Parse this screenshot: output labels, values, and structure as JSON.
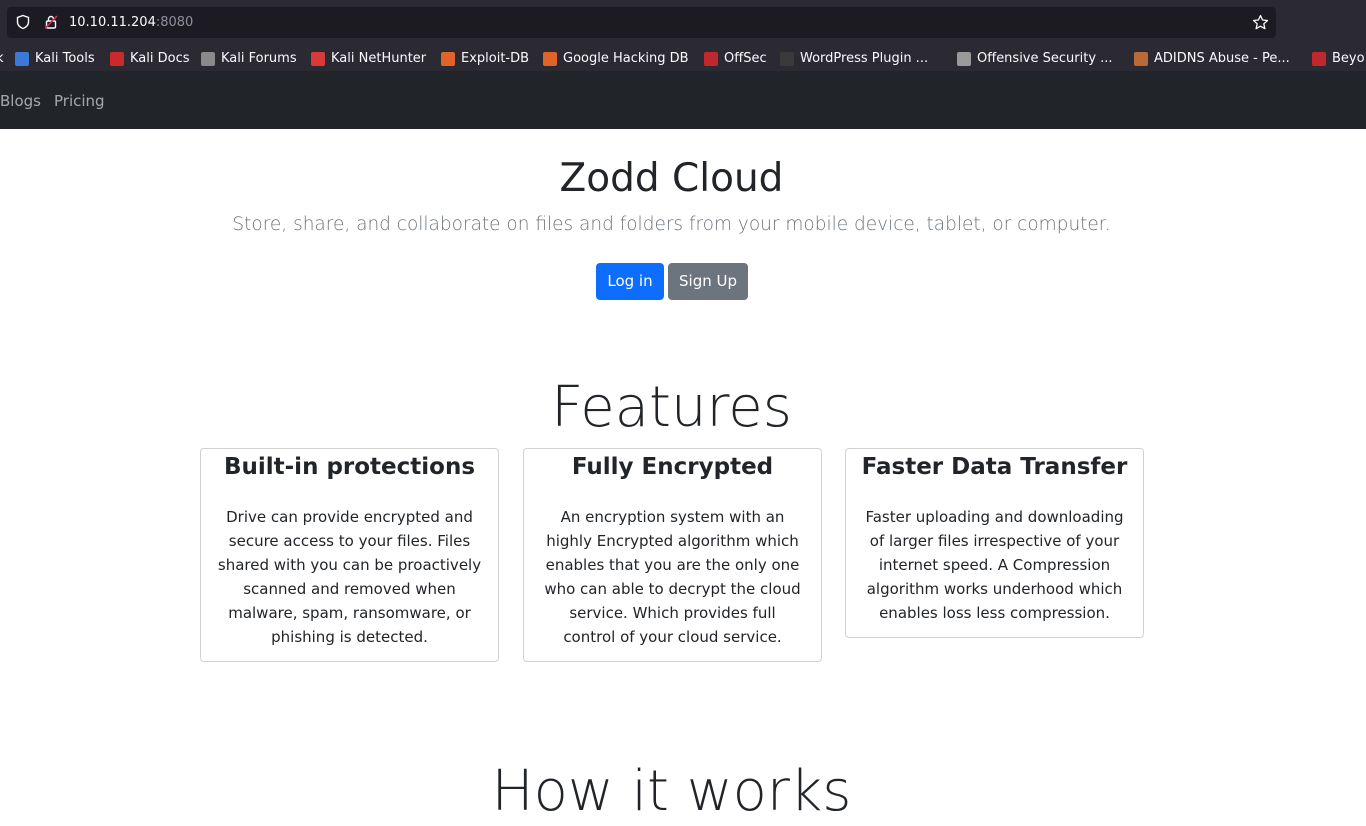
{
  "browser": {
    "url_host": "10.10.11.204",
    "url_port": ":8080",
    "bookmarks": [
      {
        "label": "k",
        "color": "#6e6e78"
      },
      {
        "label": "Kali Tools",
        "color": "#3c78d8"
      },
      {
        "label": "Kali Docs",
        "color": "#cc2a2a"
      },
      {
        "label": "Kali Forums",
        "color": "#8a8a8a"
      },
      {
        "label": "Kali NetHunter",
        "color": "#d83a3a"
      },
      {
        "label": "Exploit-DB",
        "color": "#e0642a"
      },
      {
        "label": "Google Hacking DB",
        "color": "#e0642a"
      },
      {
        "label": "OffSec",
        "color": "#c0282d"
      },
      {
        "label": "WordPress Plugin ...",
        "color": "#3a3a3a"
      },
      {
        "label": "Offensive Security ...",
        "color": "#9a9a9a"
      },
      {
        "label": "ADIDNS Abuse - Pe...",
        "color": "#b86a3a"
      },
      {
        "label": "Beyo",
        "color": "#c0282d"
      }
    ]
  },
  "nav": {
    "items": [
      "Blogs",
      "Pricing"
    ]
  },
  "hero": {
    "title": "Zodd Cloud",
    "subtitle": "Store, share, and collaborate on files and folders from your mobile device, tablet, or computer.",
    "login_label": "Log in",
    "signup_label": "Sign Up"
  },
  "features": {
    "heading": "Features",
    "cards": [
      {
        "title": "Built-in protections",
        "text": "Drive can provide encrypted and secure access to your files. Files shared with you can be proactively scanned and removed when malware, spam, ransomware, or phishing is detected."
      },
      {
        "title": "Fully Encrypted",
        "text": "An encryption system with an highly Encrypted algorithm which enables that you are the only one who can able to decrypt the cloud service. Which provides full control of your cloud service."
      },
      {
        "title": "Faster Data Transfer",
        "text": "Faster uploading and downloading of larger files irrespective of your internet speed. A Compression algorithm works underhood which enables loss less compression."
      }
    ]
  },
  "how_it_works": {
    "heading": "How it works"
  }
}
